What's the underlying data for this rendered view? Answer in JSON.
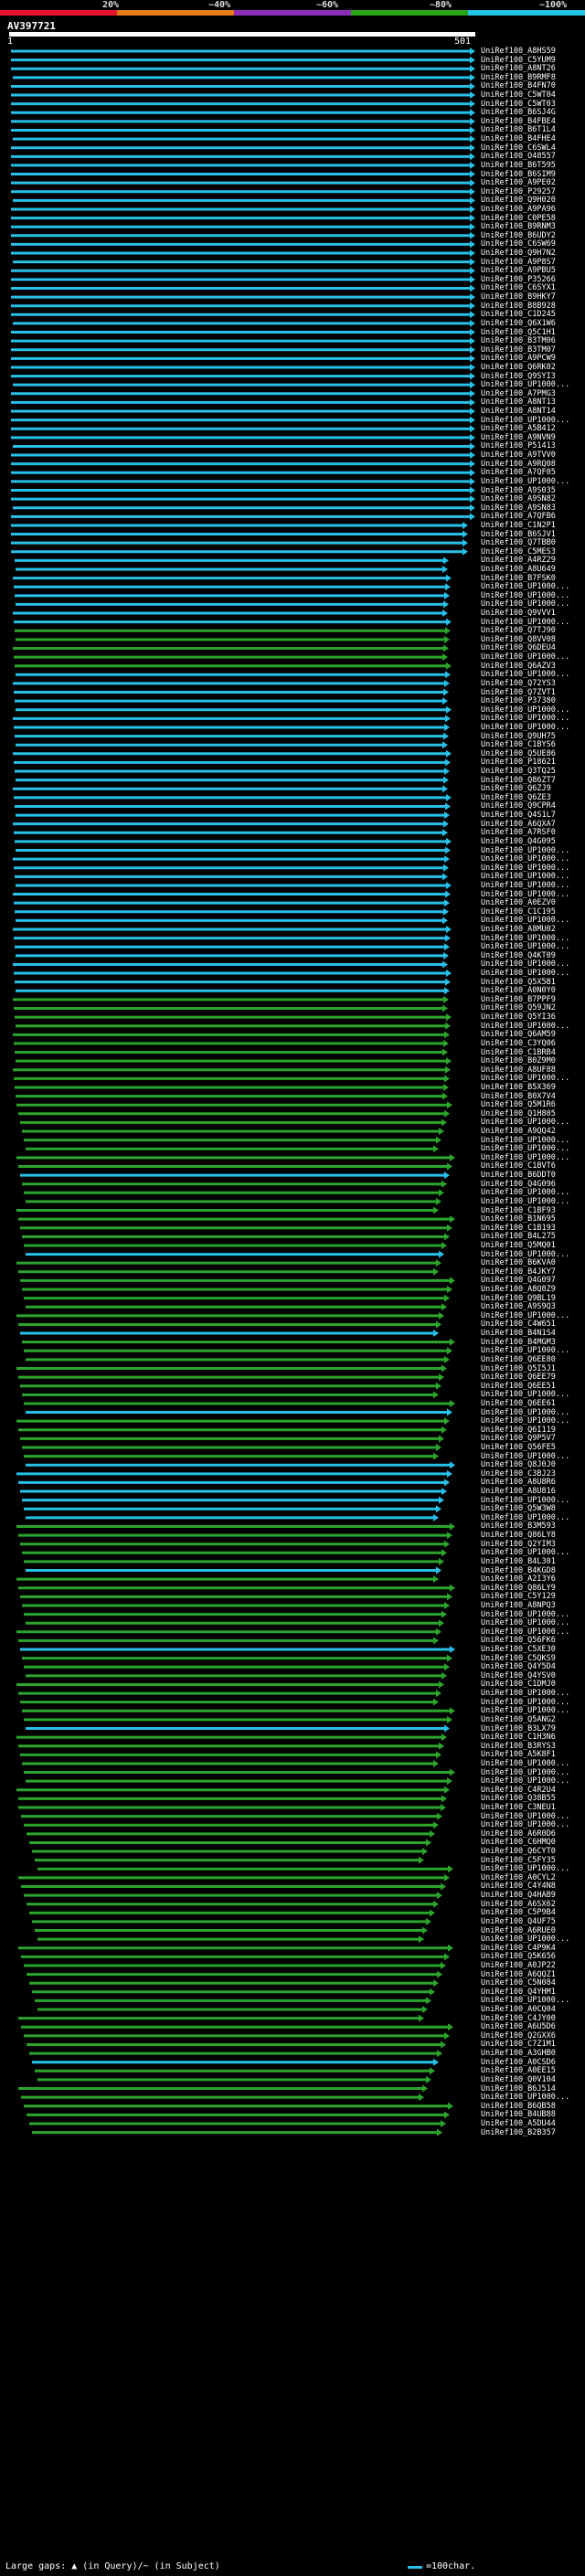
{
  "scale": {
    "labels": [
      "20%",
      "~40%",
      "~60%",
      "~80%",
      "~100%"
    ],
    "colors": [
      "#e8142d",
      "#e77b14",
      "#8b2fb8",
      "#2aa514",
      "#26c3e9"
    ]
  },
  "query": {
    "id": "AV397721",
    "start": "1",
    "end": "501"
  },
  "colors": {
    "high": "#27c0e8",
    "mid": "#2ca52c",
    "gap": "#555555"
  },
  "hits": [
    "UniRef100_A8HS59",
    "UniRef100_C5YUM9",
    "UniRef100_A8NT26",
    "UniRef100_B9RMF8",
    "UniRef100_B4FN70",
    "UniRef100_C5WT04",
    "UniRef100_C5WT03",
    "UniRef100_B6SJ4G",
    "UniRef100_B4FBE4",
    "UniRef100_B6T1L4",
    "UniRef100_B4FHE4",
    "UniRef100_C6SWL4",
    "UniRef100_O48557",
    "UniRef100_B6T595",
    "UniRef100_B6SIM9",
    "UniRef100_A9PE02",
    "UniRef100_P29257",
    "UniRef100_Q9H020",
    "UniRef100_A9PA96",
    "UniRef100_C0PE58",
    "UniRef100_B9RNM3",
    "UniRef100_B6UDY2",
    "UniRef100_C6SW69",
    "UniRef100_Q9H7N2",
    "UniRef100_A9P8S7",
    "UniRef100_A9PBU5",
    "UniRef100_P35266",
    "UniRef100_C6SYX1",
    "UniRef100_B9HKY7",
    "UniRef100_B8B928",
    "UniRef100_C1D245",
    "UniRef100_Q6X1W6",
    "UniRef100_Q5C1H1",
    "UniRef100_B3TM06",
    "UniRef100_B3TM07",
    "UniRef100_A9PCW9",
    "UniRef100_Q6RK02",
    "UniRef100_Q9SYI3",
    "UniRef100_UP1000...",
    "UniRef100_A7PMG3",
    "UniRef100_A8NT13",
    "UniRef100_A8NT14",
    "UniRef100_UP1000...",
    "UniRef100_A5B412",
    "UniRef100_A9NVN9",
    "UniRef100_P51413",
    "UniRef100_A9TVV0",
    "UniRef100_A9RQ08",
    "UniRef100_A7QF05",
    "UniRef100_UP1000...",
    "UniRef100_A9S035",
    "UniRef100_A9SN82",
    "UniRef100_A9SN83",
    "UniRef100_A7QFB6",
    "UniRef100_C1N2P1",
    "UniRef100_B6SJV1",
    "UniRef100_Q7TBB0",
    "UniRef100_C5MES3",
    "UniRef100_A4RZ29",
    "UniRef100_A8U649",
    "UniRef100_B7FSK0",
    "UniRef100_UP1000...",
    "UniRef100_UP1000...",
    "UniRef100_UP1000...",
    "UniRef100_Q9VVV1",
    "UniRef100_UP1000...",
    "UniRef100_Q7TJ90",
    "UniRef100_Q8VV08",
    "UniRef100_Q6DEU4",
    "UniRef100_UP1000...",
    "UniRef100_Q6AZV3",
    "UniRef100_UP1000...",
    "UniRef100_Q72YS3",
    "UniRef100_Q7ZVT1",
    "UniRef100_P37380",
    "UniRef100_UP1000...",
    "UniRef100_UP1000...",
    "UniRef100_UP1000...",
    "UniRef100_Q9UH75",
    "UniRef100_C1BYS6",
    "UniRef100_Q5UE86",
    "UniRef100_P18621",
    "UniRef100_Q3TQ25",
    "UniRef100_Q86ZT7",
    "UniRef100_Q6ZJ9",
    "UniRef100_Q6ZE3",
    "UniRef100_Q9CPR4",
    "UniRef100_Q4S1L7",
    "UniRef100_A6QXA7",
    "UniRef100_A7RSF0",
    "UniRef100_Q4G095",
    "UniRef100_UP1000...",
    "UniRef100_UP1000...",
    "UniRef100_UP1000...",
    "UniRef100_UP1000...",
    "UniRef100_UP1000...",
    "UniRef100_UP1000...",
    "UniRef100_A0EZV0",
    "UniRef100_C1C195",
    "UniRef100_UP1000...",
    "UniRef100_A8MU02",
    "UniRef100_UP1000...",
    "UniRef100_UP1000...",
    "UniRef100_Q4KT09",
    "UniRef100_UP1000...",
    "UniRef100_UP1000...",
    "UniRef100_Q5X5B1",
    "UniRef100_A0N0Y0",
    "UniRef100_B7PPF9",
    "UniRef100_Q59JN2",
    "UniRef100_Q5YI36",
    "UniRef100_UP1000...",
    "UniRef100_Q6AM59",
    "UniRef100_C3YQ06",
    "UniRef100_C1BRB4",
    "UniRef100_B0Z9M0",
    "UniRef100_A8UF88",
    "UniRef100_UP1000...",
    "UniRef100_B5X369",
    "UniRef100_B0X7V4",
    "UniRef100_Q5M1R6",
    "UniRef100_Q1H805",
    "UniRef100_UP1000...",
    "UniRef100_A9QQ42",
    "UniRef100_UP1000...",
    "UniRef100_UP1000...",
    "UniRef100_UP1000...",
    "UniRef100_C1BVT6",
    "UniRef100_B6DDT0",
    "UniRef100_Q4G096",
    "UniRef100_UP1000...",
    "UniRef100_UP1000...",
    "UniRef100_C1BF93",
    "UniRef100_B1N695",
    "UniRef100_C1B193",
    "UniRef100_B4L275",
    "UniRef100_Q5MQ01",
    "UniRef100_UP1000...",
    "UniRef100_B6KVA0",
    "UniRef100_B4JKY7",
    "UniRef100_Q4G097",
    "UniRef100_A8Q8Z9",
    "UniRef100_Q9BL19",
    "UniRef100_A9S9Q3",
    "UniRef100_UP1000...",
    "UniRef100_C4W651",
    "UniRef100_B4N1S4",
    "UniRef100_B4MGM3",
    "UniRef100_UP1000...",
    "UniRef100_Q6EE80",
    "UniRef100_Q5I5J1",
    "UniRef100_Q6EE79",
    "UniRef100_Q6EE51",
    "UniRef100_UP1000...",
    "UniRef100_Q6EE61",
    "UniRef100_UP1000...",
    "UniRef100_UP1000...",
    "UniRef100_Q6I119",
    "UniRef100_Q9P5V7",
    "UniRef100_Q56FE5",
    "UniRef100_UP1000...",
    "UniRef100_Q8J0J0",
    "UniRef100_C3BJ23",
    "UniRef100_A8U8R6",
    "UniRef100_A8U816",
    "UniRef100_UP1000...",
    "UniRef100_Q5W3W8",
    "UniRef100_UP1000...",
    "UniRef100_B3M593",
    "UniRef100_Q86LY8",
    "UniRef100_Q2YIM3",
    "UniRef100_UP1000...",
    "UniRef100_B4L301",
    "UniRef100_B4KGD8",
    "UniRef100_A2I3Y6",
    "UniRef100_Q86LY9",
    "UniRef100_C5Y129",
    "UniRef100_A8NPQ3",
    "UniRef100_UP1000...",
    "UniRef100_UP1000...",
    "UniRef100_UP1000...",
    "UniRef100_Q56FK6",
    "UniRef100_C5XE30",
    "UniRef100_C5QKS9",
    "UniRef100_Q4Y5D4",
    "UniRef100_Q4YSV0",
    "UniRef100_C1DMJ0",
    "UniRef100_UP1000...",
    "UniRef100_UP1000...",
    "UniRef100_UP1000...",
    "UniRef100_Q5ANG2",
    "UniRef100_B3LX79",
    "UniRef100_C1H3N6",
    "UniRef100_B3RYS3",
    "UniRef100_A5K8F1",
    "UniRef100_UP1000...",
    "UniRef100_UP1000...",
    "UniRef100_UP1000...",
    "UniRef100_C4R2U4",
    "UniRef100_Q38B55",
    "UniRef100_C3NEU1",
    "UniRef100_UP1000...",
    "UniRef100_UP1000...",
    "UniRef100_A6R0D6",
    "UniRef100_C6HMQ0",
    "UniRef100_Q6CYT0",
    "UniRef100_C5FY35",
    "UniRef100_UP1000...",
    "UniRef100_A0CYL2",
    "UniRef100_C4Y4N8",
    "UniRef100_Q4HAB9",
    "UniRef100_A6SX62",
    "UniRef100_C5P9B4",
    "UniRef100_Q4UF75",
    "UniRef100_A6RUE0",
    "UniRef100_UP1000...",
    "UniRef100_C4P9K4",
    "UniRef100_Q5K656",
    "UniRef100_A0JP22",
    "UniRef100_A6QQZ1",
    "UniRef100_C5N084",
    "UniRef100_Q4YHM1",
    "UniRef100_UP1000...",
    "UniRef100_A0CQ04",
    "UniRef100_C4JY00",
    "UniRef100_A6U5D6",
    "UniRef100_Q2GXX6",
    "UniRef100_C7Z1M1",
    "UniRef100_A3GHB0",
    "UniRef100_A0CSD6",
    "UniRef100_A0EE15",
    "UniRef100_Q0V104",
    "UniRef100_B6J514",
    "UniRef100_UP1000...",
    "UniRef100_B6QB58",
    "UniRef100_B4UB88",
    "UniRef100_A5DU44",
    "UniRef100_B2B357"
  ],
  "footer": {
    "gaps_text": "Large gaps: ▲ (in Query)/~ (in Subject)",
    "char_text": "=100char."
  }
}
